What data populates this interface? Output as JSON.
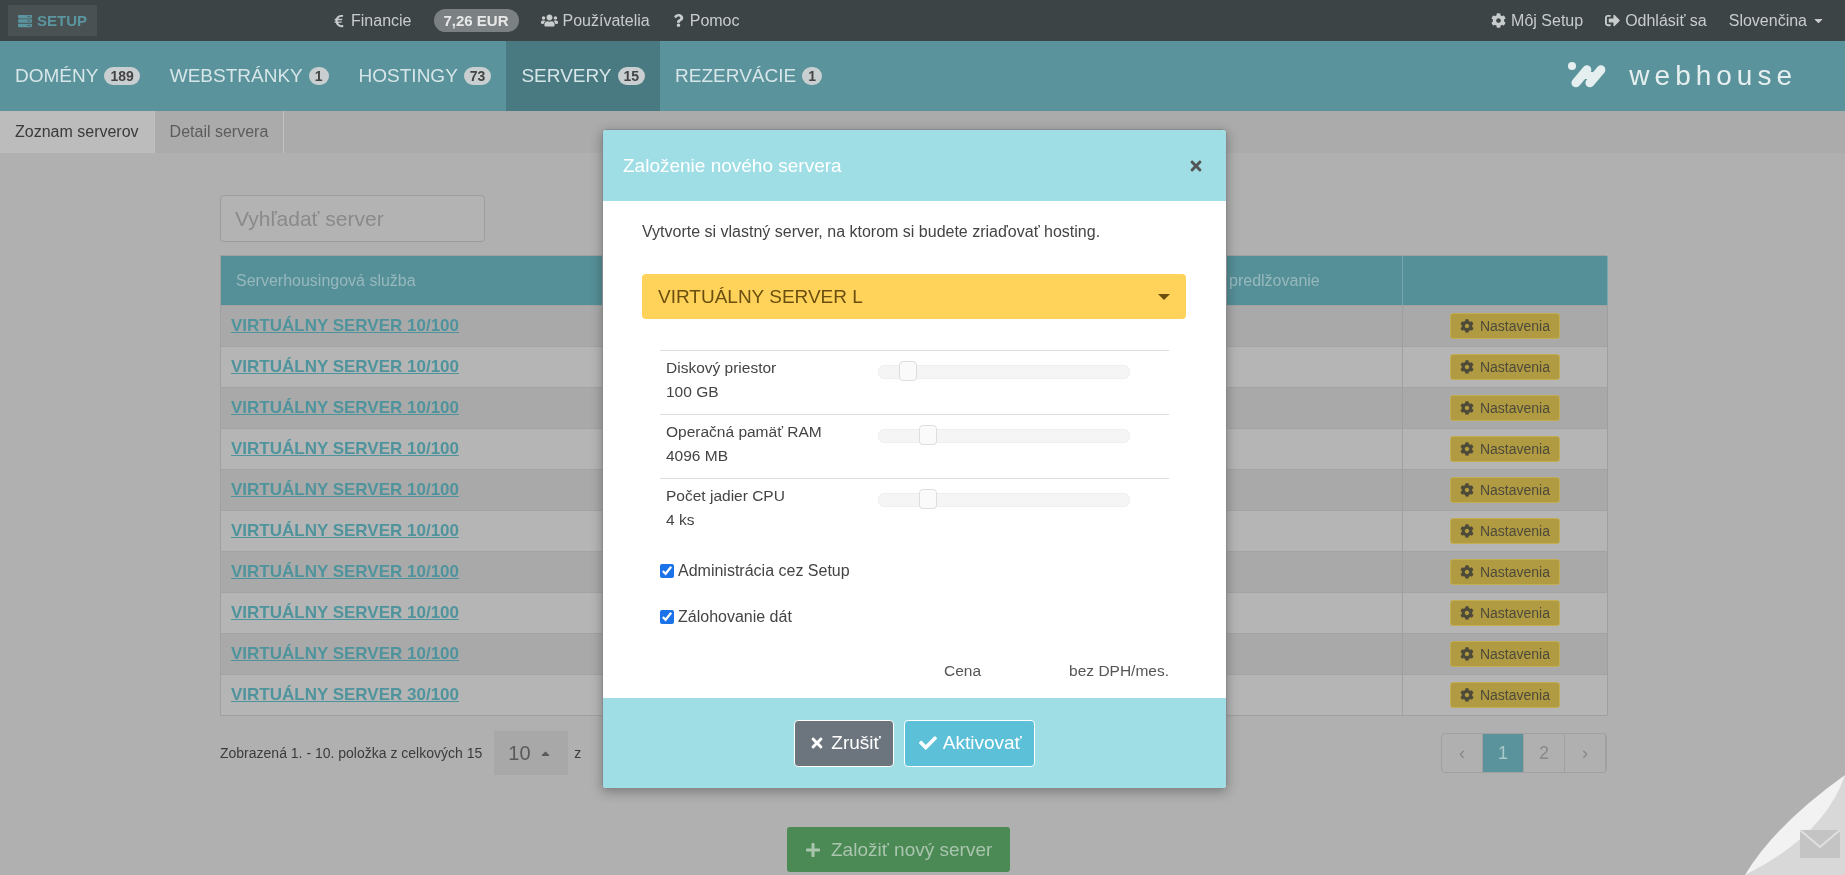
{
  "top_bar": {
    "brand": "SETUP",
    "links": [
      {
        "kind": "euro",
        "label": "Financie"
      },
      {
        "kind": "balance",
        "label": "7,26 EUR"
      },
      {
        "kind": "users",
        "label": "Používatelia"
      },
      {
        "kind": "question",
        "label": "Pomoc"
      }
    ],
    "right_links": [
      {
        "kind": "gear",
        "label": "Môj Setup"
      },
      {
        "kind": "signout",
        "label": "Odhlásiť sa"
      }
    ],
    "language": "Slovenčina"
  },
  "nav_tabs": [
    {
      "label": "DOMÉNY",
      "count": "189",
      "selected": false
    },
    {
      "label": "WEBSTRÁNKY",
      "count": "1",
      "selected": false
    },
    {
      "label": "HOSTINGY",
      "count": "73",
      "selected": false
    },
    {
      "label": "SERVERY",
      "count": "15",
      "selected": true
    },
    {
      "label": "REZERVÁCIE",
      "count": "1",
      "selected": false
    }
  ],
  "logo": "webhouse",
  "sub_tabs": [
    {
      "label": "Zoznam serverov",
      "selected": true
    },
    {
      "label": "Detail servera",
      "selected": false
    }
  ],
  "search": {
    "placeholder": "Vyhľadať server"
  },
  "table": {
    "columns": [
      "Serverhousingová služba",
      "predlžovanie"
    ],
    "rows": [
      {
        "service": "VIRTUÁLNY SERVER 10/100",
        "action": "Nastavenia"
      },
      {
        "service": "VIRTUÁLNY SERVER 10/100",
        "action": "Nastavenia"
      },
      {
        "service": "VIRTUÁLNY SERVER 10/100",
        "action": "Nastavenia"
      },
      {
        "service": "VIRTUÁLNY SERVER 10/100",
        "action": "Nastavenia"
      },
      {
        "service": "VIRTUÁLNY SERVER 10/100",
        "action": "Nastavenia"
      },
      {
        "service": "VIRTUÁLNY SERVER 10/100",
        "action": "Nastavenia"
      },
      {
        "service": "VIRTUÁLNY SERVER 10/100",
        "action": "Nastavenia"
      },
      {
        "service": "VIRTUÁLNY SERVER 10/100",
        "action": "Nastavenia"
      },
      {
        "service": "VIRTUÁLNY SERVER 10/100",
        "action": "Nastavenia"
      },
      {
        "service": "VIRTUÁLNY SERVER 30/100",
        "action": "Nastavenia"
      }
    ]
  },
  "table_footer": {
    "info": "Zobrazená 1. - 10. položka z celkových 15",
    "page_size": "10",
    "page_size_suffix": "z",
    "pagination": [
      {
        "label": "‹",
        "selected": false
      },
      {
        "label": "1",
        "selected": true
      },
      {
        "label": "2",
        "selected": false
      },
      {
        "label": "›",
        "selected": false
      }
    ]
  },
  "create_button": "Založiť nový server",
  "modal": {
    "title": "Založenie nového servera",
    "description": "Vytvorte si vlastný server, na ktorom si budete zriaďovať hosting.",
    "select_value": "VIRTUÁLNY SERVER L",
    "sliders": [
      {
        "label": "Diskový priestor",
        "value": "100 GB",
        "level": 0.08
      },
      {
        "label": "Operačná pamäť RAM",
        "value": "4096 MB",
        "level": 0.16
      },
      {
        "label": "Počet jadier CPU",
        "value": "4 ks",
        "level": 0.16
      }
    ],
    "checkboxes": [
      {
        "label": "Administrácia cez Setup",
        "checked": true
      },
      {
        "label": "Zálohovanie dát",
        "checked": true
      }
    ],
    "price": {
      "label": "Cena",
      "unit": "bez DPH/mes."
    },
    "buttons": [
      {
        "kind": "cancel",
        "label": "Zrušiť"
      },
      {
        "kind": "confirm",
        "label": "Aktivovať"
      }
    ]
  }
}
